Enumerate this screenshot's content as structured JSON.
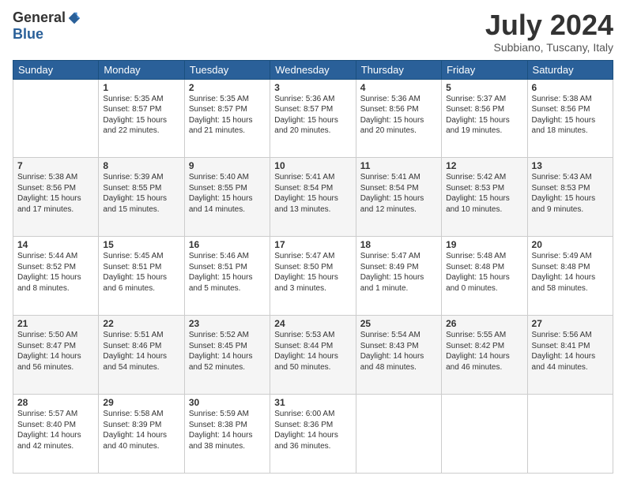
{
  "header": {
    "logo_general": "General",
    "logo_blue": "Blue",
    "month_year": "July 2024",
    "location": "Subbiano, Tuscany, Italy"
  },
  "weekdays": [
    "Sunday",
    "Monday",
    "Tuesday",
    "Wednesday",
    "Thursday",
    "Friday",
    "Saturday"
  ],
  "weeks": [
    [
      {
        "day": "",
        "sunrise": "",
        "sunset": "",
        "daylight": ""
      },
      {
        "day": "1",
        "sunrise": "Sunrise: 5:35 AM",
        "sunset": "Sunset: 8:57 PM",
        "daylight": "Daylight: 15 hours and 22 minutes."
      },
      {
        "day": "2",
        "sunrise": "Sunrise: 5:35 AM",
        "sunset": "Sunset: 8:57 PM",
        "daylight": "Daylight: 15 hours and 21 minutes."
      },
      {
        "day": "3",
        "sunrise": "Sunrise: 5:36 AM",
        "sunset": "Sunset: 8:57 PM",
        "daylight": "Daylight: 15 hours and 20 minutes."
      },
      {
        "day": "4",
        "sunrise": "Sunrise: 5:36 AM",
        "sunset": "Sunset: 8:56 PM",
        "daylight": "Daylight: 15 hours and 20 minutes."
      },
      {
        "day": "5",
        "sunrise": "Sunrise: 5:37 AM",
        "sunset": "Sunset: 8:56 PM",
        "daylight": "Daylight: 15 hours and 19 minutes."
      },
      {
        "day": "6",
        "sunrise": "Sunrise: 5:38 AM",
        "sunset": "Sunset: 8:56 PM",
        "daylight": "Daylight: 15 hours and 18 minutes."
      }
    ],
    [
      {
        "day": "7",
        "sunrise": "Sunrise: 5:38 AM",
        "sunset": "Sunset: 8:56 PM",
        "daylight": "Daylight: 15 hours and 17 minutes."
      },
      {
        "day": "8",
        "sunrise": "Sunrise: 5:39 AM",
        "sunset": "Sunset: 8:55 PM",
        "daylight": "Daylight: 15 hours and 15 minutes."
      },
      {
        "day": "9",
        "sunrise": "Sunrise: 5:40 AM",
        "sunset": "Sunset: 8:55 PM",
        "daylight": "Daylight: 15 hours and 14 minutes."
      },
      {
        "day": "10",
        "sunrise": "Sunrise: 5:41 AM",
        "sunset": "Sunset: 8:54 PM",
        "daylight": "Daylight: 15 hours and 13 minutes."
      },
      {
        "day": "11",
        "sunrise": "Sunrise: 5:41 AM",
        "sunset": "Sunset: 8:54 PM",
        "daylight": "Daylight: 15 hours and 12 minutes."
      },
      {
        "day": "12",
        "sunrise": "Sunrise: 5:42 AM",
        "sunset": "Sunset: 8:53 PM",
        "daylight": "Daylight: 15 hours and 10 minutes."
      },
      {
        "day": "13",
        "sunrise": "Sunrise: 5:43 AM",
        "sunset": "Sunset: 8:53 PM",
        "daylight": "Daylight: 15 hours and 9 minutes."
      }
    ],
    [
      {
        "day": "14",
        "sunrise": "Sunrise: 5:44 AM",
        "sunset": "Sunset: 8:52 PM",
        "daylight": "Daylight: 15 hours and 8 minutes."
      },
      {
        "day": "15",
        "sunrise": "Sunrise: 5:45 AM",
        "sunset": "Sunset: 8:51 PM",
        "daylight": "Daylight: 15 hours and 6 minutes."
      },
      {
        "day": "16",
        "sunrise": "Sunrise: 5:46 AM",
        "sunset": "Sunset: 8:51 PM",
        "daylight": "Daylight: 15 hours and 5 minutes."
      },
      {
        "day": "17",
        "sunrise": "Sunrise: 5:47 AM",
        "sunset": "Sunset: 8:50 PM",
        "daylight": "Daylight: 15 hours and 3 minutes."
      },
      {
        "day": "18",
        "sunrise": "Sunrise: 5:47 AM",
        "sunset": "Sunset: 8:49 PM",
        "daylight": "Daylight: 15 hours and 1 minute."
      },
      {
        "day": "19",
        "sunrise": "Sunrise: 5:48 AM",
        "sunset": "Sunset: 8:48 PM",
        "daylight": "Daylight: 15 hours and 0 minutes."
      },
      {
        "day": "20",
        "sunrise": "Sunrise: 5:49 AM",
        "sunset": "Sunset: 8:48 PM",
        "daylight": "Daylight: 14 hours and 58 minutes."
      }
    ],
    [
      {
        "day": "21",
        "sunrise": "Sunrise: 5:50 AM",
        "sunset": "Sunset: 8:47 PM",
        "daylight": "Daylight: 14 hours and 56 minutes."
      },
      {
        "day": "22",
        "sunrise": "Sunrise: 5:51 AM",
        "sunset": "Sunset: 8:46 PM",
        "daylight": "Daylight: 14 hours and 54 minutes."
      },
      {
        "day": "23",
        "sunrise": "Sunrise: 5:52 AM",
        "sunset": "Sunset: 8:45 PM",
        "daylight": "Daylight: 14 hours and 52 minutes."
      },
      {
        "day": "24",
        "sunrise": "Sunrise: 5:53 AM",
        "sunset": "Sunset: 8:44 PM",
        "daylight": "Daylight: 14 hours and 50 minutes."
      },
      {
        "day": "25",
        "sunrise": "Sunrise: 5:54 AM",
        "sunset": "Sunset: 8:43 PM",
        "daylight": "Daylight: 14 hours and 48 minutes."
      },
      {
        "day": "26",
        "sunrise": "Sunrise: 5:55 AM",
        "sunset": "Sunset: 8:42 PM",
        "daylight": "Daylight: 14 hours and 46 minutes."
      },
      {
        "day": "27",
        "sunrise": "Sunrise: 5:56 AM",
        "sunset": "Sunset: 8:41 PM",
        "daylight": "Daylight: 14 hours and 44 minutes."
      }
    ],
    [
      {
        "day": "28",
        "sunrise": "Sunrise: 5:57 AM",
        "sunset": "Sunset: 8:40 PM",
        "daylight": "Daylight: 14 hours and 42 minutes."
      },
      {
        "day": "29",
        "sunrise": "Sunrise: 5:58 AM",
        "sunset": "Sunset: 8:39 PM",
        "daylight": "Daylight: 14 hours and 40 minutes."
      },
      {
        "day": "30",
        "sunrise": "Sunrise: 5:59 AM",
        "sunset": "Sunset: 8:38 PM",
        "daylight": "Daylight: 14 hours and 38 minutes."
      },
      {
        "day": "31",
        "sunrise": "Sunrise: 6:00 AM",
        "sunset": "Sunset: 8:36 PM",
        "daylight": "Daylight: 14 hours and 36 minutes."
      },
      {
        "day": "",
        "sunrise": "",
        "sunset": "",
        "daylight": ""
      },
      {
        "day": "",
        "sunrise": "",
        "sunset": "",
        "daylight": ""
      },
      {
        "day": "",
        "sunrise": "",
        "sunset": "",
        "daylight": ""
      }
    ]
  ]
}
